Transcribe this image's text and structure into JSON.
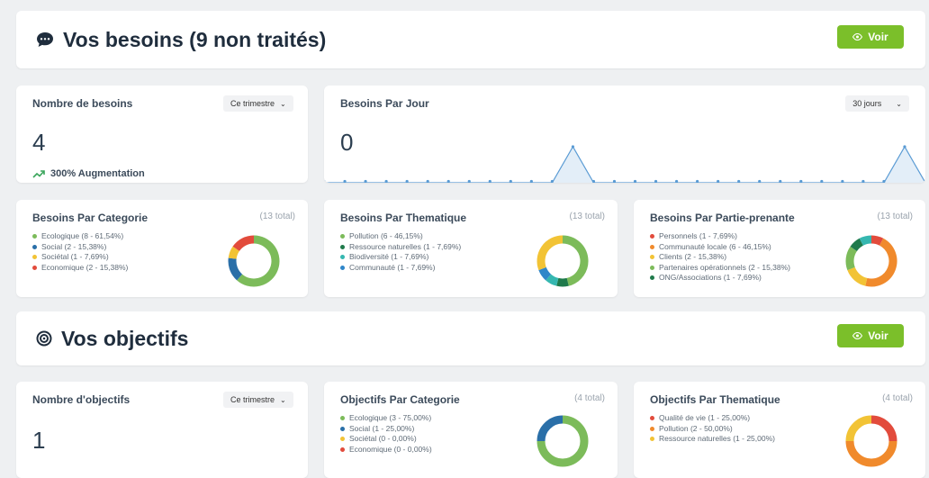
{
  "besoins": {
    "title": "Vos besoins (9 non traités)",
    "voir_label": "Voir",
    "nombre": {
      "title": "Nombre de besoins",
      "select": "Ce trimestre",
      "value": "4",
      "increase": "300% Augmentation"
    },
    "par_jour": {
      "title": "Besoins Par Jour",
      "select": "30 jours",
      "value": "0"
    },
    "categorie": {
      "title": "Besoins Par Categorie",
      "total": "(13 total)",
      "items": [
        {
          "label": "Ecologique (8 - 61,54%)",
          "color": "#7cbb5a",
          "value": 61.54
        },
        {
          "label": "Social (2 - 15,38%)",
          "color": "#2a6fa8",
          "value": 15.38
        },
        {
          "label": "Sociétal (1 - 7,69%)",
          "color": "#f2c335",
          "value": 7.69
        },
        {
          "label": "Economique (2 - 15,38%)",
          "color": "#e24b3c",
          "value": 15.38
        }
      ]
    },
    "thematique": {
      "title": "Besoins Par Thematique",
      "total": "(13 total)",
      "items": [
        {
          "label": "Pollution (6 - 46,15%)",
          "color": "#7cbb5a",
          "value": 46.15
        },
        {
          "label": "Ressource naturelles (1 - 7,69%)",
          "color": "#1f7a4b",
          "value": 7.69
        },
        {
          "label": "Biodiversité (1 - 7,69%)",
          "color": "#35b7b0",
          "value": 7.69
        },
        {
          "label": "Communauté (1 - 7,69%)",
          "color": "#2f86c9",
          "value": 7.69
        }
      ],
      "donut_extra": [
        {
          "color": "#f2c335",
          "value": 30.78
        }
      ]
    },
    "partie": {
      "title": "Besoins Par Partie-prenante",
      "total": "(13 total)",
      "items": [
        {
          "label": "Personnels (1 - 7,69%)",
          "color": "#e24b3c",
          "value": 7.69
        },
        {
          "label": "Communauté locale (6 - 46,15%)",
          "color": "#f08a2c",
          "value": 46.15
        },
        {
          "label": "Clients (2 - 15,38%)",
          "color": "#f2c335",
          "value": 15.38
        },
        {
          "label": "Partenaires opérationnels (2 - 15,38%)",
          "color": "#7cbb5a",
          "value": 15.38
        },
        {
          "label": "ONG/Associations (1 - 7,69%)",
          "color": "#1f7a4b",
          "value": 7.69
        }
      ],
      "donut_extra": [
        {
          "color": "#35b7b0",
          "value": 7.71
        }
      ]
    }
  },
  "objectifs": {
    "title": "Vos objectifs",
    "voir_label": "Voir",
    "nombre": {
      "title": "Nombre d'objectifs",
      "select": "Ce trimestre",
      "value": "1"
    },
    "categorie": {
      "title": "Objectifs Par Categorie",
      "total": "(4 total)",
      "items": [
        {
          "label": "Ecologique (3 - 75,00%)",
          "color": "#7cbb5a",
          "value": 75
        },
        {
          "label": "Social (1 - 25,00%)",
          "color": "#2a6fa8",
          "value": 25
        },
        {
          "label": "Sociétal (0 - 0,00%)",
          "color": "#f2c335",
          "value": 0
        },
        {
          "label": "Economique (0 - 0,00%)",
          "color": "#e24b3c",
          "value": 0
        }
      ]
    },
    "thematique": {
      "title": "Objectifs Par Thematique",
      "total": "(4 total)",
      "items": [
        {
          "label": "Qualité de vie (1 - 25,00%)",
          "color": "#e24b3c",
          "value": 25
        },
        {
          "label": "Pollution (2 - 50,00%)",
          "color": "#f08a2c",
          "value": 50
        },
        {
          "label": "Ressource naturelles (1 - 25,00%)",
          "color": "#f2c335",
          "value": 25
        }
      ]
    }
  },
  "chart_data": {
    "type": "area",
    "values": [
      0,
      0,
      0,
      0,
      0,
      0,
      0,
      0,
      0,
      0,
      0,
      0,
      1,
      0,
      0,
      0,
      0,
      0,
      0,
      0,
      0,
      0,
      0,
      0,
      0,
      0,
      0,
      0,
      1,
      0
    ]
  }
}
